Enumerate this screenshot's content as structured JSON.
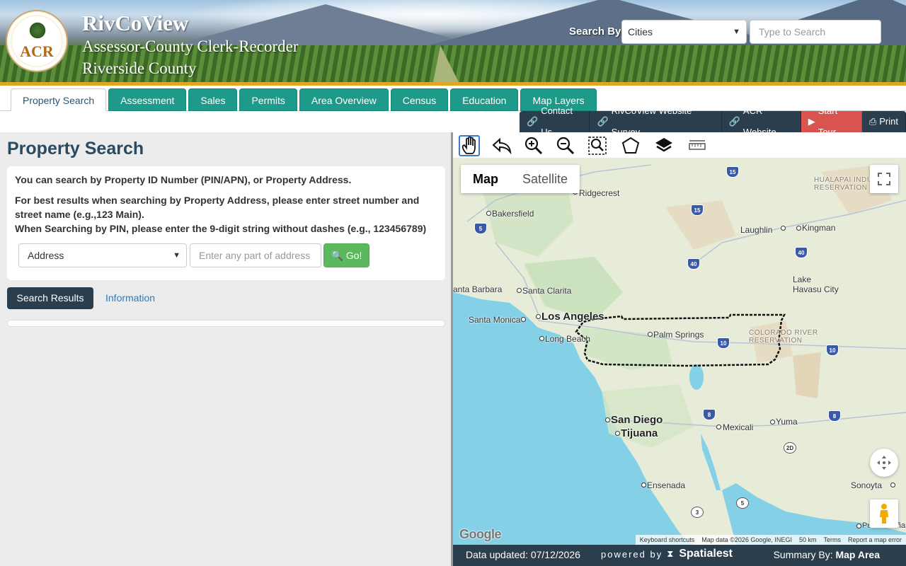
{
  "header": {
    "title": "RivCoView",
    "subtitle": "Assessor-County Clerk-Recorder",
    "county": "Riverside County",
    "logo_text": "ACR",
    "search_by_label": "Search By:",
    "search_by_value": "Cities",
    "search_placeholder": "Type to Search"
  },
  "tabs": [
    {
      "label": "Property Search",
      "active": true
    },
    {
      "label": "Assessment"
    },
    {
      "label": "Sales"
    },
    {
      "label": "Permits"
    },
    {
      "label": "Area Overview"
    },
    {
      "label": "Census"
    },
    {
      "label": "Education"
    },
    {
      "label": "Map Layers"
    }
  ],
  "toolbar_links": {
    "contact": "Contact Us",
    "survey": "RivCoView Website Survey",
    "acr": "ACR Website",
    "tour": "Start Tour",
    "print": "Print"
  },
  "left": {
    "heading": "Property Search",
    "intro": "You can search by Property ID Number (PIN/APN), or Property Address.",
    "tip1": "For best results when searching by Property Address, please enter street number and street name (e.g.,123 Main).",
    "tip2": "When Searching by PIN, please enter the 9-digit string without dashes (e.g., 123456789)",
    "mode_value": "Address",
    "address_placeholder": "Enter any part of address",
    "go_label": "Go!",
    "results_label": "Search Results",
    "info_label": "Information"
  },
  "map": {
    "type_map": "Map",
    "type_satellite": "Satellite",
    "labels": {
      "ridgecrest": "Ridgecrest",
      "bakersfield": "Bakersfield",
      "laughlin": "Laughlin",
      "kingman": "Kingman",
      "hualapai": "HUALAPAI INDIAN",
      "hualapai2": "RESERVATION",
      "lake_havasu": "Lake",
      "lake_havasu2": "Havasu City",
      "santa_barbara": "anta Barbara",
      "santa_clarita": "Santa Clarita",
      "los_angeles": "Los Angeles",
      "santa_monica": "Santa Monica",
      "long_beach": "Long Beach",
      "palm_springs": "Palm Springs",
      "colorado_river": "COLORADO RIVER",
      "colorado_river2": "RESERVATION",
      "san_diego": "San Diego",
      "tijuana": "Tijuana",
      "mexicali": "Mexicali",
      "yuma": "Yuma",
      "ensenada": "Ensenada",
      "sonoyta": "Sonoyta",
      "puerto": "Puerto Peñasco"
    },
    "shields": [
      "15",
      "15",
      "5",
      "40",
      "40",
      "10",
      "10",
      "8",
      "8",
      "5",
      "3",
      "2D"
    ],
    "google": "Google",
    "attribution": {
      "shortcuts": "Keyboard shortcuts",
      "data": "Map data ©2026 Google, INEGI",
      "scale": "50 km",
      "terms": "Terms",
      "report": "Report a map error"
    }
  },
  "footer": {
    "updated": "Data updated: 07/12/2026",
    "powered": "powered by",
    "brand": "Spatialest",
    "summary_label": "Summary By:",
    "summary_value": "Map Area"
  },
  "colors": {
    "teal_tab": "#1d9a8a",
    "navy": "#2b3e4d",
    "gold": "#e0a521",
    "go_green": "#5cb85c",
    "tour_red": "#d9534f"
  }
}
